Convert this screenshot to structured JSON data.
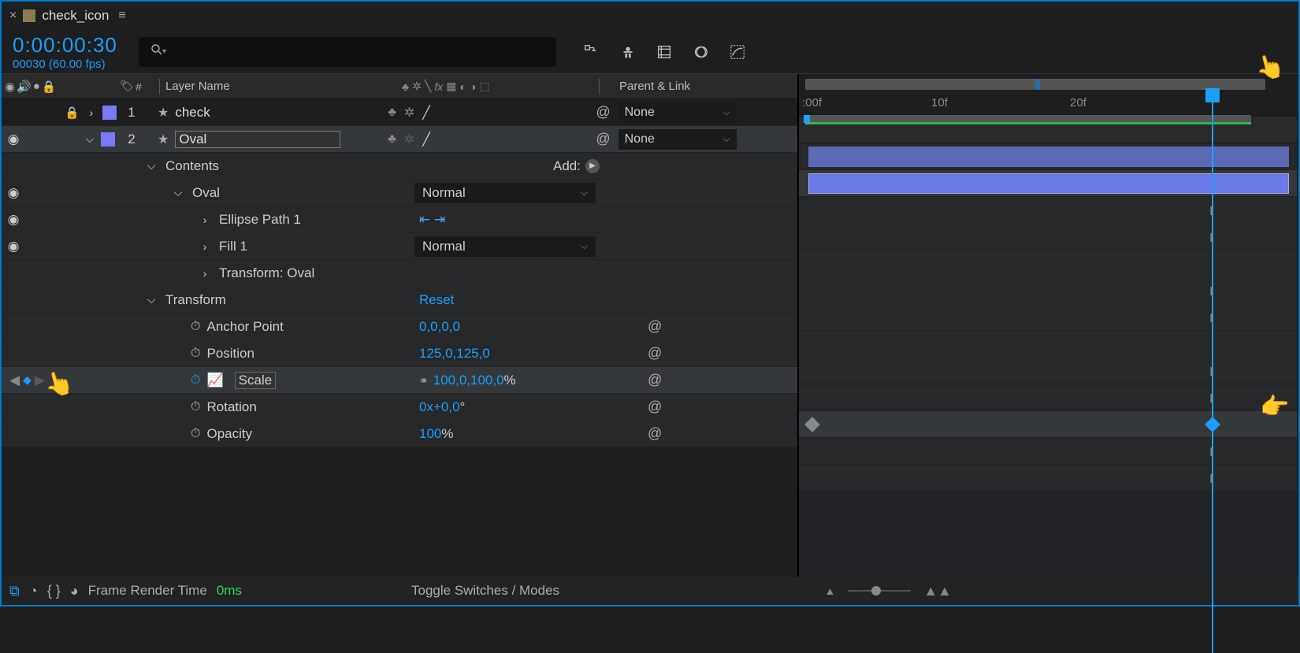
{
  "tab": {
    "label": "check_icon"
  },
  "timecode": {
    "main": "0:00:00:30",
    "sub": "00030 (60.00 fps)"
  },
  "columns": {
    "layer_name": "Layer Name",
    "parent_link": "Parent & Link"
  },
  "layers": [
    {
      "num": "1",
      "name": "check",
      "parent": "None",
      "locked": true,
      "visible": false,
      "expanded": false
    },
    {
      "num": "2",
      "name": "Oval",
      "parent": "None",
      "locked": false,
      "visible": true,
      "expanded": true,
      "selected": true
    }
  ],
  "contents": {
    "header": "Contents",
    "add_label": "Add:",
    "groups": [
      {
        "name": "Oval",
        "mode": "Normal",
        "expanded": true
      },
      {
        "name": "Ellipse Path 1",
        "expanded": false
      },
      {
        "name": "Fill 1",
        "mode": "Normal",
        "expanded": false
      },
      {
        "name": "Transform: Oval",
        "expanded": false
      }
    ]
  },
  "transform": {
    "header": "Transform",
    "reset": "Reset",
    "props": [
      {
        "name": "Anchor Point",
        "value": "0,0,0,0",
        "animated": false
      },
      {
        "name": "Position",
        "value": "125,0,125,0",
        "animated": false
      },
      {
        "name": "Scale",
        "value": "100,0,100,0",
        "unit": "%",
        "animated": true,
        "linked": true,
        "selected": true
      },
      {
        "name": "Rotation",
        "value_prefix": "0",
        "value": "x+0,0",
        "unit": "°",
        "animated": false
      },
      {
        "name": "Opacity",
        "value": "100",
        "unit": "%",
        "animated": false
      }
    ]
  },
  "ruler": {
    "ticks": [
      ":00f",
      "10f",
      "20f"
    ]
  },
  "footer": {
    "render_label": "Frame Render Time",
    "render_value": "0ms",
    "toggle": "Toggle Switches / Modes"
  },
  "hash": "#"
}
